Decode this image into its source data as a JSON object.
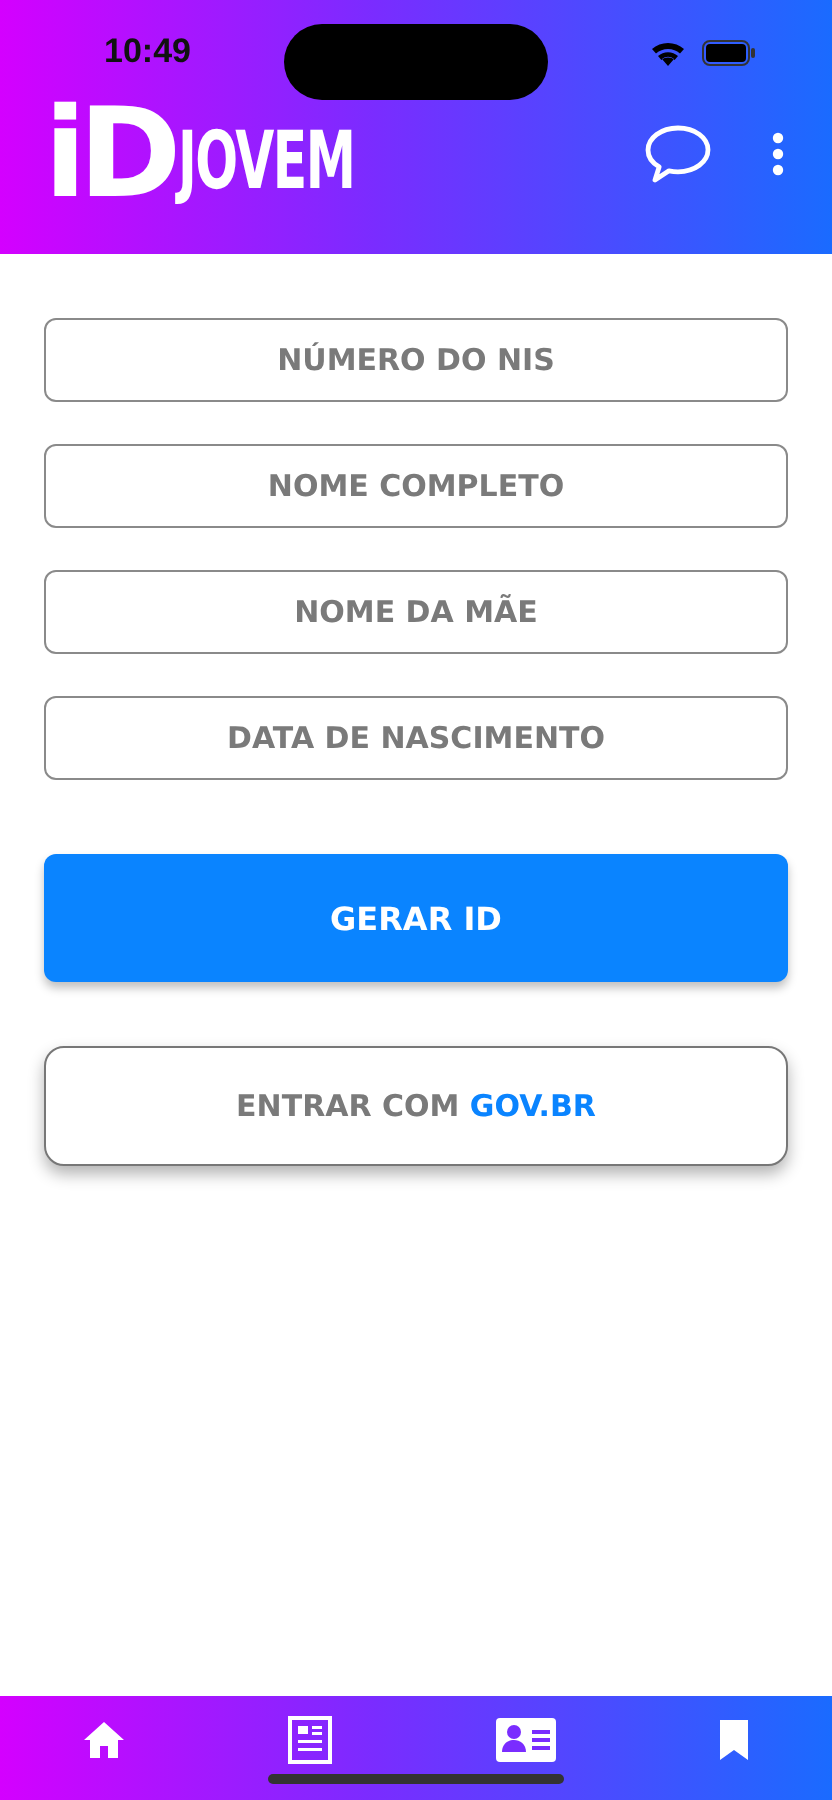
{
  "status_bar": {
    "time": "10:49"
  },
  "header": {
    "logo_mark": "iD",
    "logo_word": "JOVEM"
  },
  "fields": [
    {
      "placeholder": "NÚMERO DO NIS"
    },
    {
      "placeholder": "NOME COMPLETO"
    },
    {
      "placeholder": "NOME DA MÃE"
    },
    {
      "placeholder": "DATA DE NASCIMENTO"
    }
  ],
  "primary_button": "GERAR ID",
  "govbr_button": {
    "prefix": "ENTRAR COM ",
    "brand": "GOV.BR"
  },
  "bottom_nav": [
    {
      "kind": "home"
    },
    {
      "kind": "news"
    },
    {
      "kind": "card"
    },
    {
      "kind": "bookmark"
    }
  ]
}
